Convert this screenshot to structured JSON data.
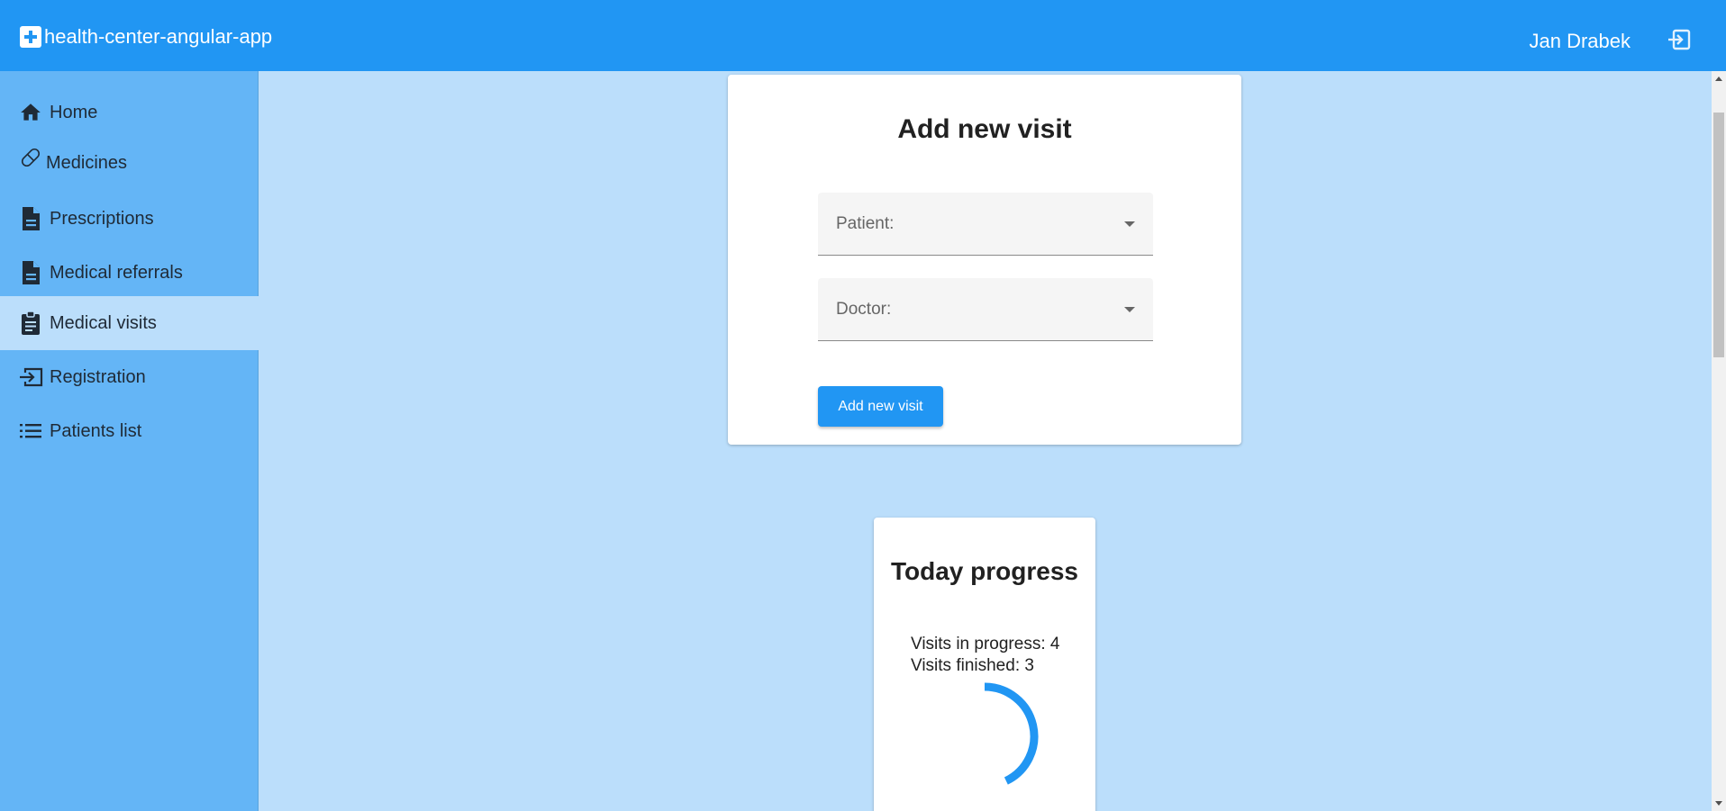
{
  "header": {
    "brand_icon": "medical-cross-icon",
    "title": "health-center-angular-app",
    "user_name": "Jan Drabek",
    "logout_icon": "logout-icon",
    "background_color": "#2196f3"
  },
  "sidebar": {
    "background_color": "#64b5f6",
    "active_color": "#bbdefb",
    "items": [
      {
        "label": "Home",
        "icon": "home-icon",
        "active": false
      },
      {
        "label": "Medicines",
        "icon": "pill-icon",
        "active": false
      },
      {
        "label": "Prescriptions",
        "icon": "document-icon",
        "active": false
      },
      {
        "label": "Medical referrals",
        "icon": "document-icon",
        "active": false
      },
      {
        "label": "Medical visits",
        "icon": "clipboard-icon",
        "active": true
      },
      {
        "label": "Registration",
        "icon": "login-icon",
        "active": false
      },
      {
        "label": "Patients list",
        "icon": "list-icon",
        "active": false
      }
    ]
  },
  "visit_form": {
    "title": "Add new visit",
    "patient_placeholder": "Patient:",
    "doctor_placeholder": "Doctor:",
    "submit_label": "Add new visit"
  },
  "progress": {
    "title": "Today progress",
    "in_progress_text": "Visits in progress: 4",
    "finished_text": "Visits finished: 3",
    "visits_in_progress": 4,
    "visits_finished": 3,
    "accent_color": "#2196f3"
  }
}
